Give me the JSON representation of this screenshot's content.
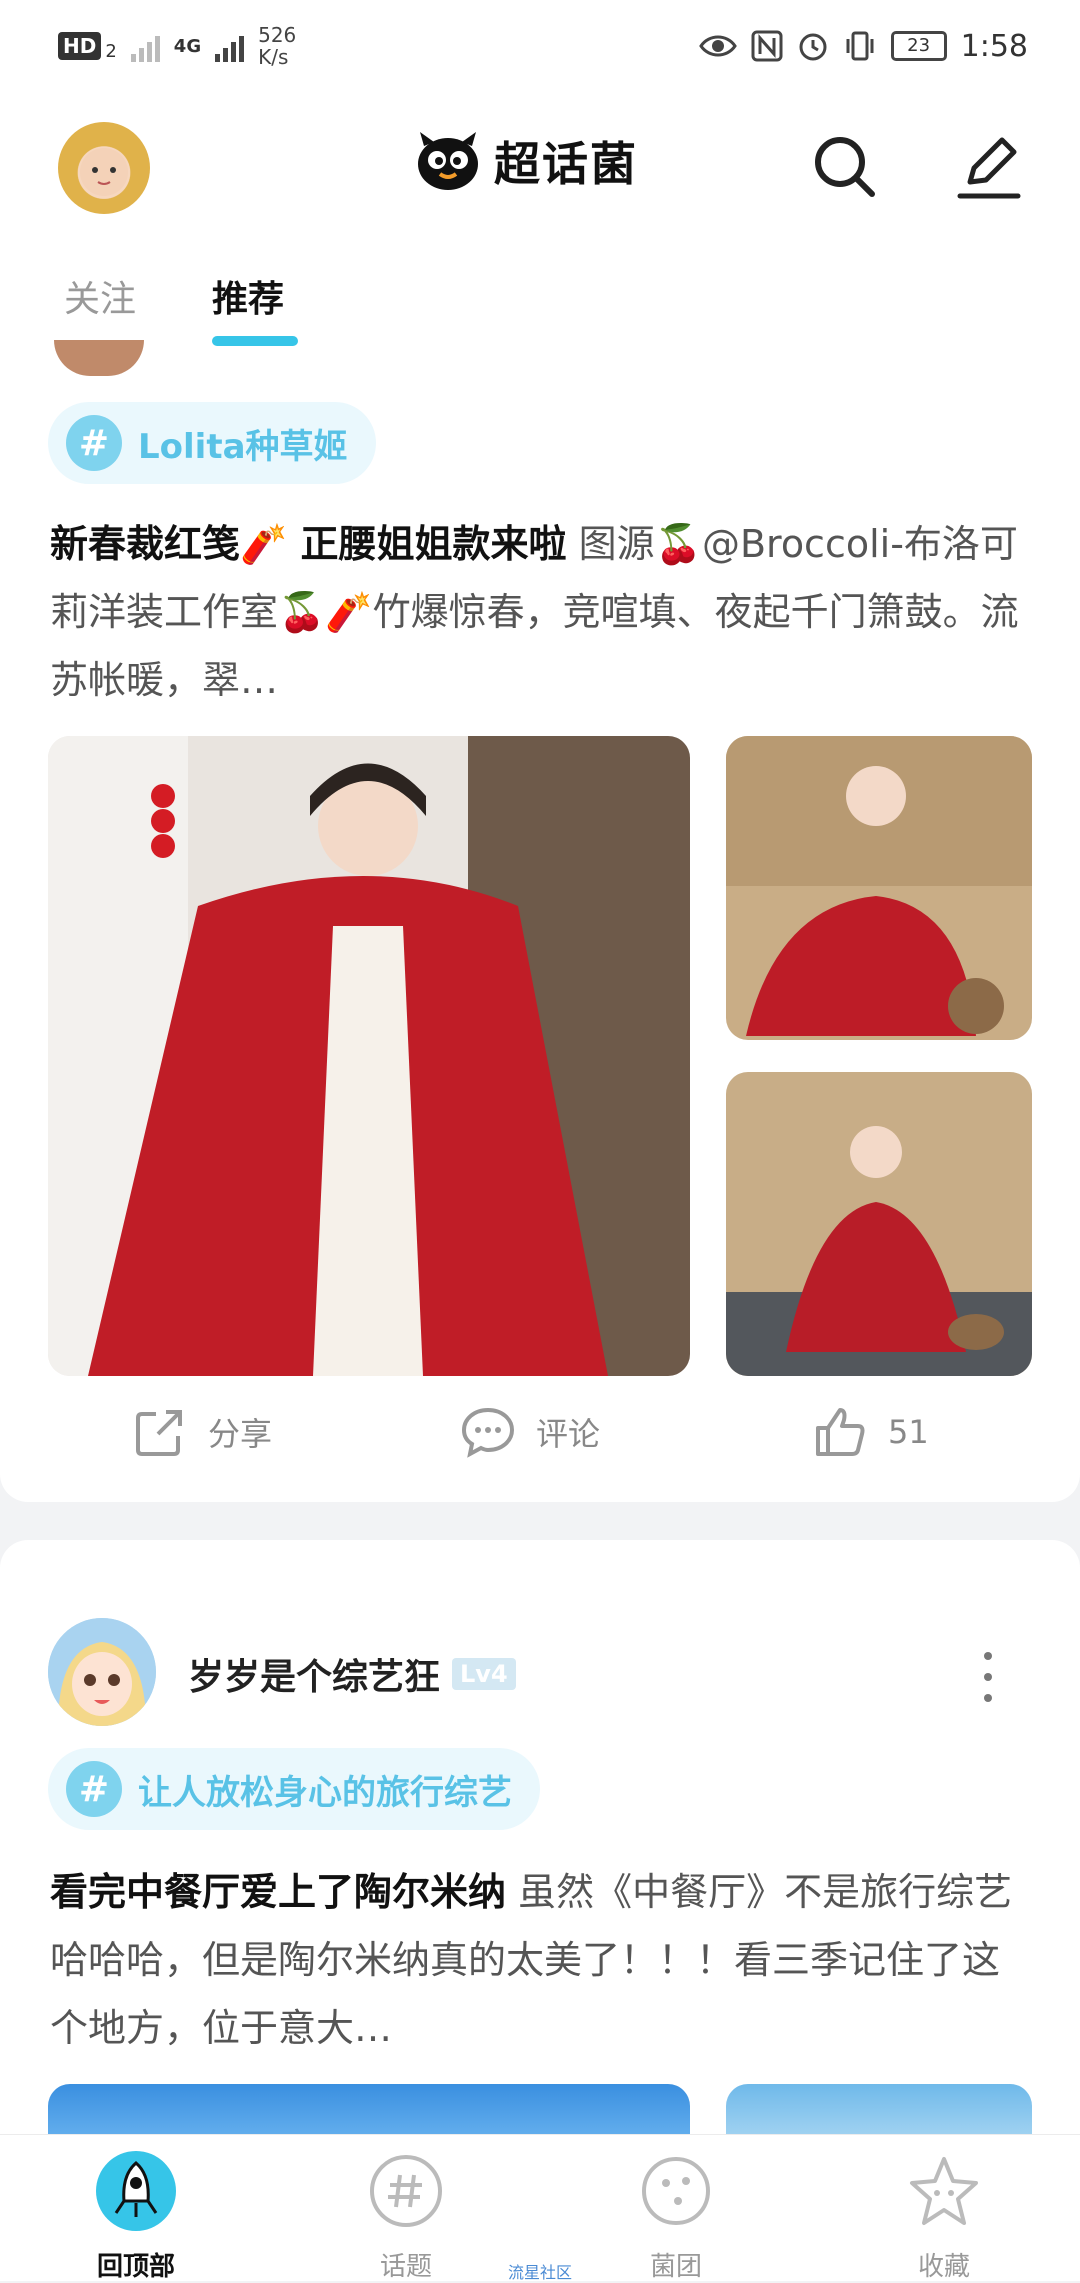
{
  "status_bar": {
    "hd": "HD",
    "sim": "2",
    "network": "4G",
    "speed_value": "526",
    "speed_unit": "K/s",
    "battery": "23",
    "time": "1:58"
  },
  "header": {
    "logo_text": "超话菌"
  },
  "tabs": [
    {
      "label": "关注"
    },
    {
      "label": "推荐"
    }
  ],
  "post1": {
    "topic": "Lolita种草姬",
    "title": "新春裁红笺🧨 正腰姐姐款来啦",
    "body": "图源🍒@Broccoli-布洛可莉洋装工作室🍒🧨竹爆惊春，竞喧填、夜起千门箫鼓。流苏帐暖，翠…",
    "actions": {
      "share": "分享",
      "comment": "评论",
      "likes": "51"
    }
  },
  "post2": {
    "author": "岁岁是个综艺狂",
    "level": "Lv4",
    "topic": "让人放松身心的旅行综艺",
    "title": "看完中餐厅爱上了陶尔米纳",
    "body": "虽然《中餐厅》不是旅行综艺哈哈哈，但是陶尔米纳真的太美了！！！看三季记住了这个地方，位于意大…"
  },
  "bottom_nav": [
    {
      "label": "回顶部"
    },
    {
      "label": "话题"
    },
    {
      "label": "菌团"
    },
    {
      "label": "收藏"
    }
  ],
  "bottom_caption": "流星社区",
  "colors": {
    "accent": "#36c5e8",
    "topic_bg": "#eaf8fd",
    "topic_text": "#59c2e6"
  }
}
